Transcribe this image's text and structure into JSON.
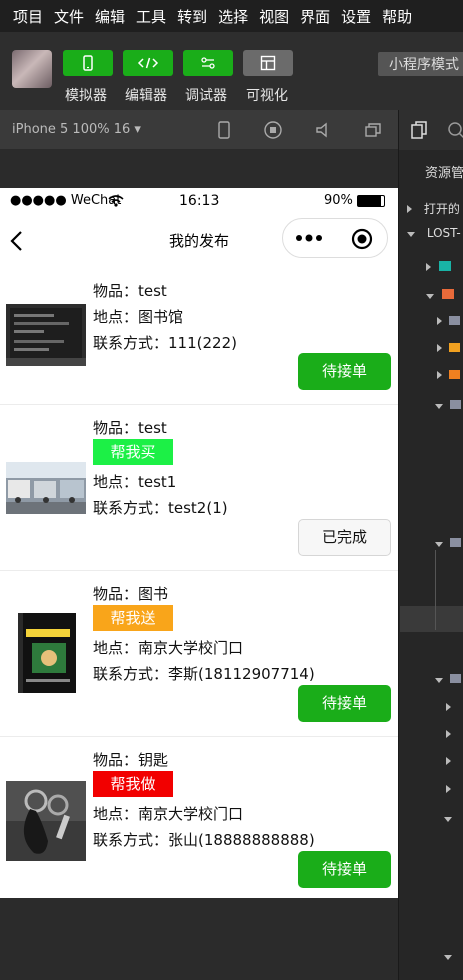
{
  "menu": [
    "项目",
    "文件",
    "编辑",
    "工具",
    "转到",
    "选择",
    "视图",
    "界面",
    "设置",
    "帮助"
  ],
  "toolbar": {
    "simulator_label": "模拟器",
    "editor_label": "编辑器",
    "debugger_label": "调试器",
    "visual_label": "可视化",
    "mode_label": "小程序模式"
  },
  "simbar": {
    "device_label": "iPhone 5 100% 16 ▾"
  },
  "right_panel": {
    "tab_label": "资源管",
    "open_label": "打开的",
    "project_label": "LOST-"
  },
  "phone": {
    "status": {
      "carrier": "●●●●● WeChat",
      "time": "16:13",
      "battery": "90%"
    },
    "nav": {
      "title": "我的发布"
    },
    "cards": [
      {
        "item": "物品：test",
        "location": "地点：图书馆",
        "contact": "联系方式：111(222)",
        "action": "待接单"
      },
      {
        "item": "物品：test",
        "tag": "帮我买",
        "location": "地点：test1",
        "contact": "联系方式：test2(1)",
        "action": "已完成"
      },
      {
        "item": "物品：图书",
        "tag": "帮我送",
        "location": "地点：南京大学校门口",
        "contact": "联系方式：李斯(18112907714)",
        "action": "待接单"
      },
      {
        "item": "物品：钥匙",
        "tag": "帮我做",
        "location": "地点：南京大学校门口",
        "contact": "联系方式：张山(18888888888)",
        "action": "待接单"
      }
    ]
  },
  "colors": {
    "wechat_green": "#1aad19",
    "tag_buy": "#1cf046",
    "tag_send": "#f9a51a",
    "tag_do": "#f20000"
  }
}
